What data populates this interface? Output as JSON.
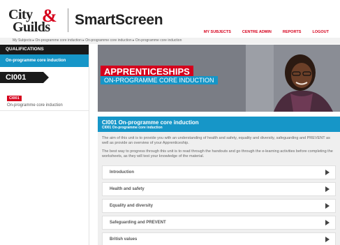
{
  "header": {
    "logo_line1": "City",
    "logo_amp": "&",
    "logo_line2": "Guilds",
    "brand": "SmartScreen",
    "nav": [
      "MY SUBJECTS",
      "CENTRE ADMIN",
      "REPORTS",
      "LOGOUT"
    ]
  },
  "breadcrumb": "My Subjects ▸ On-programme core induction ▸ On-programme core induction ▸ On-programme core induction",
  "sidebar": {
    "section_title": "QUALIFICATIONS",
    "qualification": "On-programme core induction",
    "unit_code": "CI001",
    "selected_badge": "CI001",
    "selected_title": "On-programme core induction"
  },
  "banner": {
    "title": "APPRENTICESHIPS",
    "subtitle": "ON-PROGRAMME CORE INDUCTION"
  },
  "content": {
    "title": "CI001 On-programme core induction",
    "subtitle": "CI001 On-programme core induction",
    "para1": "The aim of this unit is to provide you with an understanding of health and safety, equality and diversity, safeguarding and PREVENT as well as provide an overview of your Apprenticeship.",
    "para2": "The best way to progress through this unit is to read through the handouts and go through the e-learning activities before completing the worksheets, as they will test your knowledge of the material.",
    "modules": [
      "Introduction",
      "Health and safety",
      "Equality and diversity",
      "Safeguarding and PREVENT",
      "British values"
    ]
  },
  "colors": {
    "accent_red": "#d6001c",
    "accent_blue": "#1696c8",
    "dark": "#1a1a1a"
  }
}
